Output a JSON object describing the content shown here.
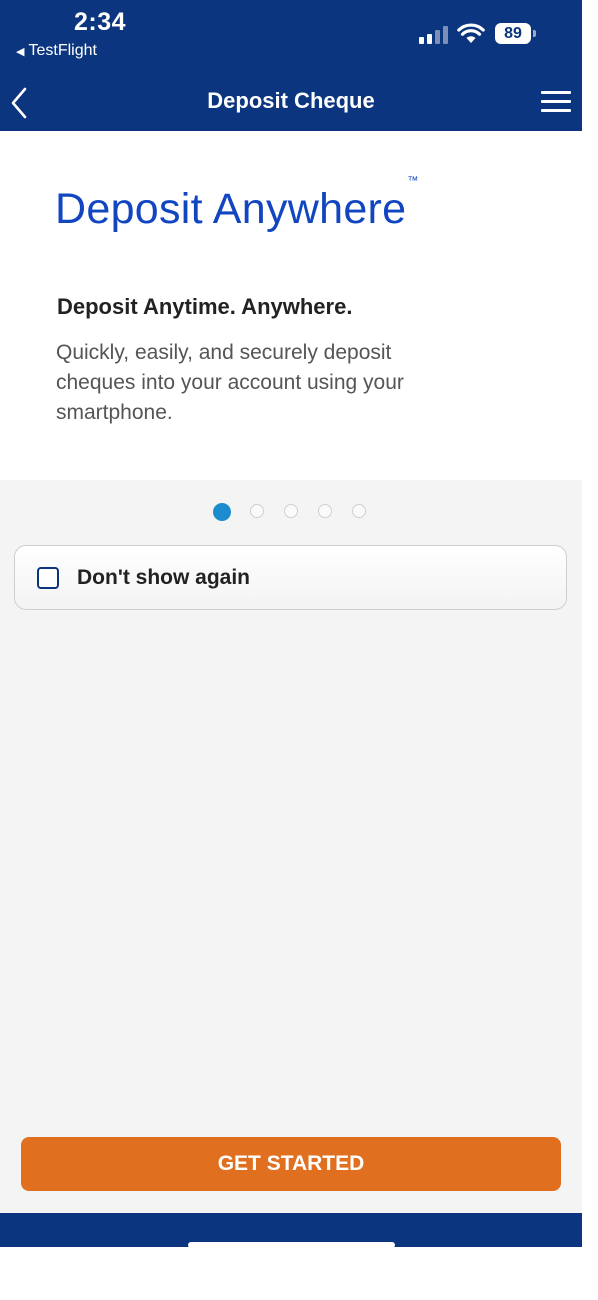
{
  "status_bar": {
    "time": "2:34",
    "back_app": "TestFlight",
    "battery": "89"
  },
  "nav": {
    "title": "Deposit Cheque"
  },
  "hero": {
    "brand": "Deposit Anywhere",
    "brand_mark": "™",
    "headline": "Deposit Anytime. Anywhere.",
    "subtext": "Quickly, easily, and securely deposit cheques into your account using your smartphone."
  },
  "pager": {
    "total": 5,
    "active": 1
  },
  "dont_show": {
    "label": "Don't show again",
    "checked": false
  },
  "cta": {
    "label": "GET STARTED"
  },
  "colors": {
    "brand_blue": "#0c3580",
    "accent_orange": "#e07020",
    "dot_active": "#1d8ccf"
  }
}
